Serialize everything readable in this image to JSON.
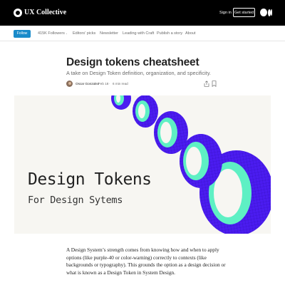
{
  "header": {
    "brand": "UX Collective",
    "signin_label": "Sign in",
    "get_started_label": "Get started"
  },
  "nav": {
    "follow_label": "Follow",
    "followers_label": "415K Followers",
    "links": [
      "Editors' picks",
      "Newsletter",
      "Leading with Craft",
      "Publish a story",
      "About"
    ]
  },
  "article": {
    "title": "Design tokens cheatsheet",
    "subtitle": "A take on Design Token definition, organization, and specificity.",
    "author": "Oscar Gonzalez",
    "date": "Feb 18",
    "separator": "·",
    "read_time": "6 min read"
  },
  "hero": {
    "title": "Design Tokens",
    "subtitle": "For Design Sytems",
    "colors": {
      "purple": "#4b1cf0",
      "mint": "#5ef0c4",
      "background": "#f7f6f2"
    }
  },
  "body": {
    "lines": [
      "A Design System’s strength comes from knowing how and when to apply",
      "options (like purple-40 or color-warning) correctly to contexts (like",
      "backgrounds or typography). This grounds the option as a design decision or",
      "what is known as a Design Token in System Design."
    ]
  },
  "colors": {
    "topbar": "#000000",
    "follow_button": "#1a8bca",
    "text_primary": "#242424",
    "text_secondary": "#6b6b6b"
  },
  "icons": [
    "logo-icon",
    "medium-logo-icon",
    "share-icon",
    "bookmark-icon"
  ]
}
